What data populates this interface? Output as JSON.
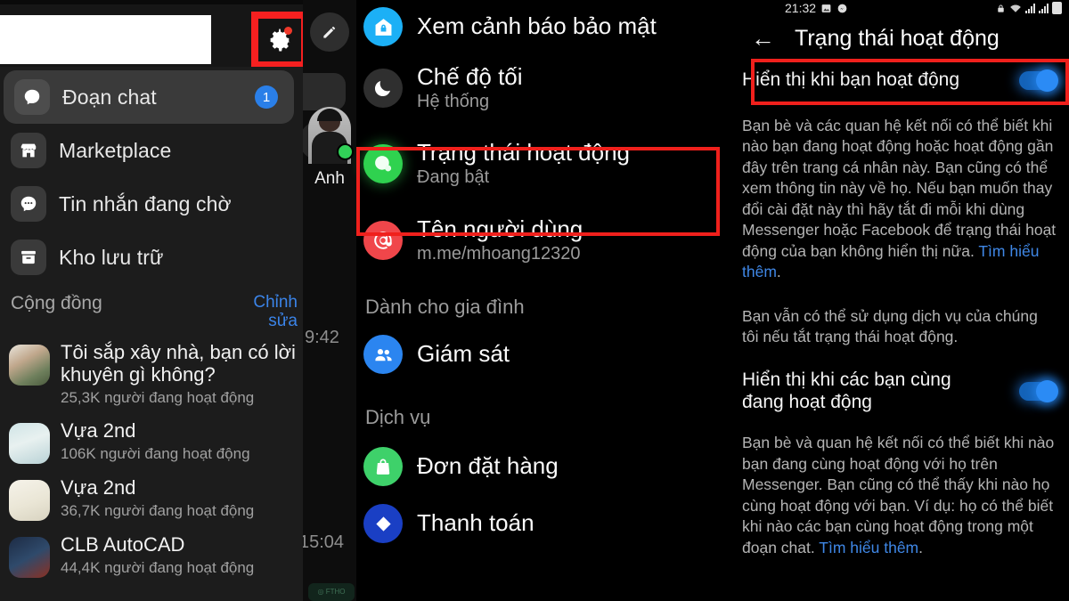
{
  "left_panel": {
    "search_bar": {
      "value": "",
      "placeholder": ""
    },
    "gear_icon_name": "settings-gear-icon",
    "menu": [
      {
        "label": "Đoạn chat",
        "icon": "chat-bubble-icon",
        "badge": "1",
        "selected": true
      },
      {
        "label": "Marketplace",
        "icon": "storefront-icon",
        "badge": "",
        "selected": false
      },
      {
        "label": "Tin nhắn đang chờ",
        "icon": "pending-messages-icon",
        "badge": "",
        "selected": false
      },
      {
        "label": "Kho lưu trữ",
        "icon": "archive-box-icon",
        "badge": "",
        "selected": false
      }
    ],
    "community": {
      "title": "Cộng đồng",
      "edit_label": "Chỉnh sửa",
      "items": [
        {
          "name": "Tôi sắp xây nhà, bạn có lời khuyên gì không?",
          "sub": "25,3K người đang hoạt động"
        },
        {
          "name": "Vựa 2nd",
          "sub": "106K người đang hoạt động"
        },
        {
          "name": "Vựa 2nd",
          "sub": "36,7K người đang hoạt động"
        },
        {
          "name": "CLB AutoCAD",
          "sub": "44,4K người đang hoạt động"
        }
      ]
    }
  },
  "mid_panel": {
    "compose_icon": "pencil-compose-icon",
    "avatar_name": "Anh",
    "timestamps": [
      "9:42",
      "15:04"
    ],
    "rows": [
      {
        "type": "item",
        "title": "Xem cảnh báo bảo mật",
        "sub": "",
        "icon": "security-home-lock-icon",
        "color": "#1cb0f6"
      },
      {
        "type": "item",
        "title": "Chế độ tối",
        "sub": "Hệ thống",
        "icon": "moon-icon",
        "color": "#2f2f2f"
      },
      {
        "type": "item",
        "title": "Trạng thái hoạt động",
        "sub": "Đang bật",
        "icon": "active-status-icon",
        "color": "#2fd24f",
        "highlighted": true
      },
      {
        "type": "item",
        "title": "Tên người dùng",
        "sub": "m.me/mhoang12320",
        "icon": "at-sign-icon",
        "color": "#f0464a"
      },
      {
        "type": "section",
        "title": "Dành cho gia đình"
      },
      {
        "type": "item",
        "title": "Giám sát",
        "sub": "",
        "icon": "supervision-people-icon",
        "color": "#2b85f0"
      },
      {
        "type": "section",
        "title": "Dịch vụ"
      },
      {
        "type": "item",
        "title": "Đơn đặt hàng",
        "sub": "",
        "icon": "shopping-bag-icon",
        "color": "#3ed16a"
      },
      {
        "type": "item",
        "title": "Thanh toán",
        "sub": "",
        "icon": "payment-card-icon",
        "color": "#1a3fc4"
      }
    ]
  },
  "right_panel": {
    "status_bar": {
      "time": "21:32",
      "icons_left": [
        "photo-icon",
        "messenger-icon"
      ],
      "icons_right": [
        "lock-icon",
        "wifi-icon",
        "signal-1-icon",
        "signal-2-icon",
        "battery-icon"
      ]
    },
    "header": {
      "back_icon": "back-arrow-icon",
      "title": "Trạng thái hoạt động"
    },
    "settings": [
      {
        "label": "Hiển thị khi bạn hoạt động",
        "toggle_on": true,
        "highlighted": true,
        "description": "Bạn bè và các quan hệ kết nối có thể biết khi nào bạn đang hoạt động hoặc hoạt động gần đây trên trang cá nhân này. Bạn cũng có thể xem thông tin này về họ. Nếu bạn muốn thay đổi cài đặt này thì hãy tắt đi mỗi khi dùng Messenger hoặc Facebook để trạng thái hoạt động của bạn không hiển thị nữa. ",
        "link": "Tìm hiểu thêm",
        "note": "Bạn vẫn có thể sử dụng dịch vụ của chúng tôi nếu tắt trạng thái hoạt động."
      },
      {
        "label": "Hiển thị khi các bạn cùng đang hoạt động",
        "toggle_on": true,
        "highlighted": false,
        "description": "Bạn bè và quan hệ kết nối có thể biết khi nào bạn đang cùng hoạt động với họ trên Messenger. Bạn cũng có thể thấy khi nào họ cùng hoạt động với bạn. Ví dụ: họ có thể biết khi nào các bạn cùng hoạt động trong một đoạn chat. ",
        "link": "Tìm hiểu thêm",
        "note": ""
      }
    ]
  },
  "colors": {
    "highlight_red": "#f0201c",
    "accent_blue": "#2b8bf5",
    "link_blue": "#3f87e6",
    "badge_blue": "#2a7fe8",
    "active_green": "#2fd24f"
  }
}
